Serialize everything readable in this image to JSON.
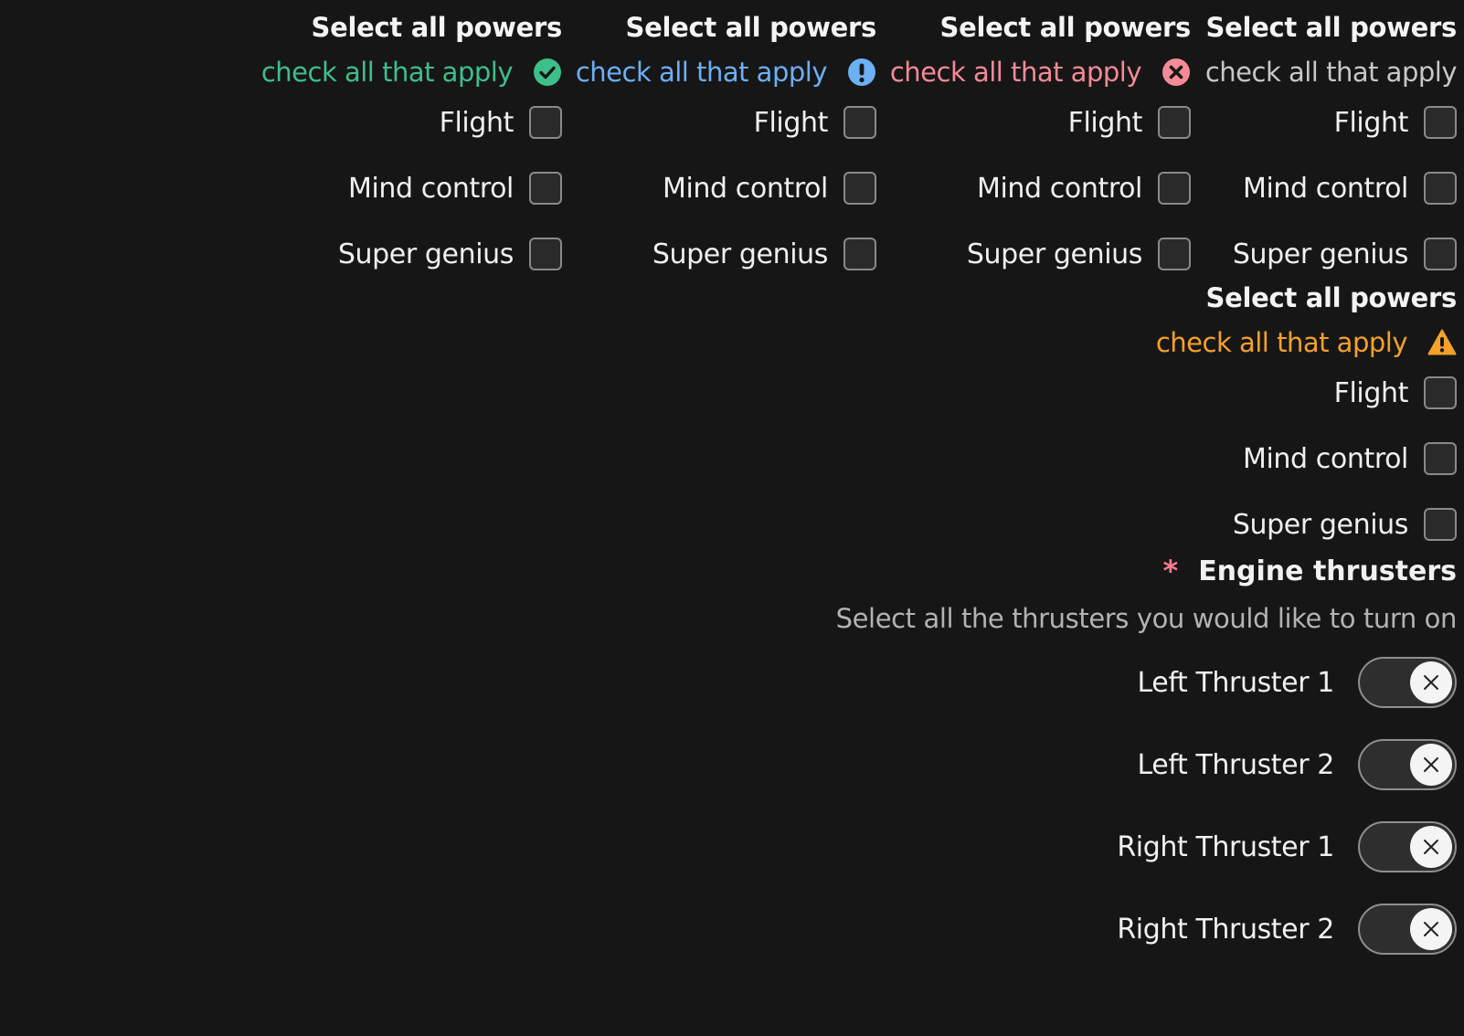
{
  "groups": [
    {
      "title": "Select all powers",
      "subtitle": "check all that apply",
      "status": "success",
      "status_icon": "check-circle-icon",
      "color": "#3dbf8a",
      "options": [
        "Flight",
        "Mind control",
        "Super genius"
      ]
    },
    {
      "title": "Select all powers",
      "subtitle": "check all that apply",
      "status": "info",
      "status_icon": "exclamation-circle-icon",
      "color": "#6cb0f5",
      "options": [
        "Flight",
        "Mind control",
        "Super genius"
      ]
    },
    {
      "title": "Select all powers",
      "subtitle": "check all that apply",
      "status": "error",
      "status_icon": "x-circle-icon",
      "color": "#f58a97",
      "options": [
        "Flight",
        "Mind control",
        "Super genius"
      ]
    },
    {
      "title": "Select all powers",
      "subtitle": "check all that apply",
      "status": "neutral",
      "status_icon": "",
      "color": "#c8c8c8",
      "options": [
        "Flight",
        "Mind control",
        "Super genius"
      ]
    },
    {
      "title": "Select all powers",
      "subtitle": "check all that apply",
      "status": "warning",
      "status_icon": "warning-triangle-icon",
      "color": "#f5a12a",
      "options": [
        "Flight",
        "Mind control",
        "Super genius"
      ]
    }
  ],
  "engine": {
    "required_marker": "*",
    "title": "Engine thrusters",
    "subtitle": "Select all the thrusters you would like to turn on",
    "toggles": [
      {
        "label": "Left Thruster 1",
        "on": false
      },
      {
        "label": "Left Thruster 2",
        "on": false
      },
      {
        "label": "Right Thruster 1",
        "on": false
      },
      {
        "label": "Right Thruster 2",
        "on": false
      }
    ],
    "toggle_icon": "x-icon"
  },
  "colors": {
    "background": "#161616",
    "required": "#f77b8b"
  }
}
